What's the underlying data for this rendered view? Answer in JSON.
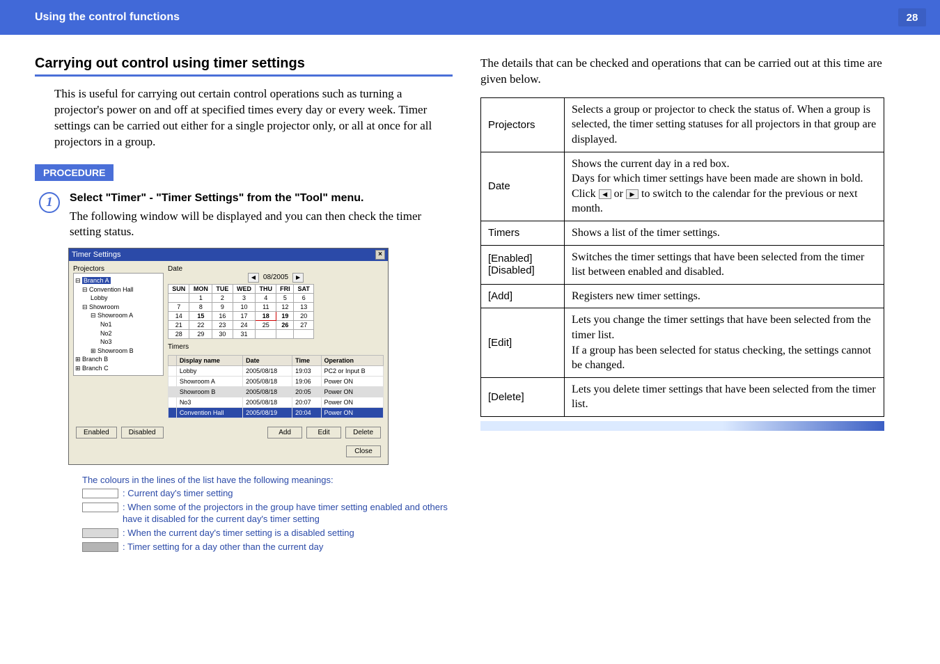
{
  "header": {
    "title": "Using the control functions",
    "page": "28"
  },
  "section_title": "Carrying out control using timer settings",
  "intro": "This is useful for carrying out certain control operations such as turning a projector's power on and off at specified times every day or every week. Timer settings can be carried out either for a single projector only, or all at once for all projectors in a group.",
  "procedure_label": "PROCEDURE",
  "step": {
    "num": "1",
    "title": "Select \"Timer\" - \"Timer Settings\" from the \"Tool\" menu.",
    "body": "The following window will be displayed and you can then check the timer setting status."
  },
  "window": {
    "title": "Timer Settings",
    "projectors_label": "Projectors",
    "date_label": "Date",
    "timers_label": "Timers",
    "month": "08/2005",
    "tree": {
      "branchA": "Branch A",
      "convHall": "Convention Hall",
      "lobby": "Lobby",
      "showroom": "Showroom",
      "showroomA": "Showroom A",
      "no1": "No1",
      "no2": "No2",
      "no3": "No3",
      "showroomB": "Showroom B",
      "branchB": "Branch B",
      "branchC": "Branch C"
    },
    "cal_days": [
      "SUN",
      "MON",
      "TUE",
      "WED",
      "THU",
      "FRI",
      "SAT"
    ],
    "cal_rows": [
      [
        "",
        "1",
        "2",
        "3",
        "4",
        "5",
        "6"
      ],
      [
        "7",
        "8",
        "9",
        "10",
        "11",
        "12",
        "13"
      ],
      [
        "14",
        "15",
        "16",
        "17",
        "18",
        "19",
        "20"
      ],
      [
        "21",
        "22",
        "23",
        "24",
        "25",
        "26",
        "27"
      ],
      [
        "28",
        "29",
        "30",
        "31",
        "",
        "",
        ""
      ]
    ],
    "timer_headers": [
      "",
      "Display name",
      "Date",
      "Time",
      "Operation"
    ],
    "timer_rows": [
      [
        "",
        "Lobby",
        "2005/08/18",
        "19:03",
        "PC2 or Input B"
      ],
      [
        "",
        "Showroom A",
        "2005/08/18",
        "19:06",
        "Power ON"
      ],
      [
        "",
        "Showroom B",
        "2005/08/18",
        "20:05",
        "Power ON"
      ],
      [
        "",
        "No3",
        "2005/08/18",
        "20:07",
        "Power ON"
      ],
      [
        "",
        "Convention Hall",
        "2005/08/19",
        "20:04",
        "Power ON"
      ]
    ],
    "buttons": {
      "enabled": "Enabled",
      "disabled": "Disabled",
      "add": "Add",
      "edit": "Edit",
      "delete": "Delete",
      "close": "Close"
    }
  },
  "legend": {
    "intro": "The colours in the lines of the list have the following meanings:",
    "l1": ": Current day's timer setting",
    "l2": ": When some of the projectors in the group have timer setting enabled and others have it disabled for the current day's timer setting",
    "l3": ": When the current day's timer setting is a disabled setting",
    "l4": ": Timer setting for a day other than the current day"
  },
  "right_intro": "The details that can be checked and operations that can be carried out at this time are given below.",
  "desc_table": {
    "rows": [
      {
        "k": "Projectors",
        "v": "Selects a group or projector to check the status of. When a group is selected, the timer setting statuses for all projectors in that group are displayed."
      },
      {
        "k": "Date",
        "v_pre": "Shows the current day in a red box.\nDays for which timer settings have been made are shown in bold.\nClick ",
        "v_post": " to switch to the calendar for the previous or next month."
      },
      {
        "k": "Timers",
        "v": "Shows a list of the timer settings."
      },
      {
        "k": "[Enabled]\n[Disabled]",
        "v": "Switches the timer settings that have been selected from the timer list between enabled and disabled."
      },
      {
        "k": "[Add]",
        "v": "Registers new timer settings."
      },
      {
        "k": "[Edit]",
        "v": "Lets you change the timer settings that have been selected from the timer list.\nIf a group has been selected for status checking, the settings cannot be changed."
      },
      {
        "k": "[Delete]",
        "v": "Lets you delete timer settings that have been selected from the timer list."
      }
    ]
  }
}
